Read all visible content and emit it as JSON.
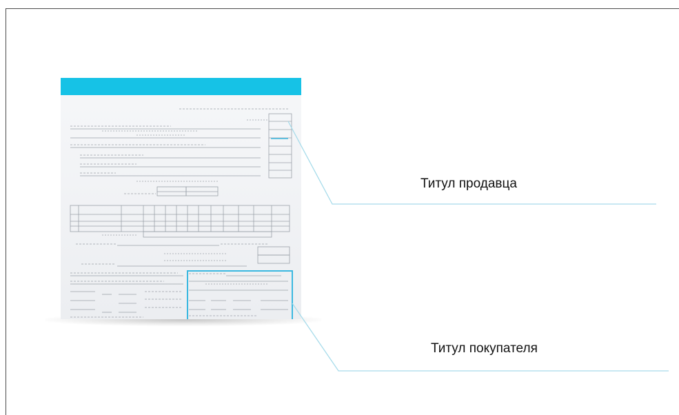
{
  "labels": {
    "seller_title": "Титул продавца",
    "buyer_title": "Титул покупателя"
  },
  "colors": {
    "header": "#16c2e6",
    "callout_line": "#9fd8e8",
    "highlight_box": "#3ab8e0"
  },
  "icons": {
    "document": "document-thumbnail"
  }
}
